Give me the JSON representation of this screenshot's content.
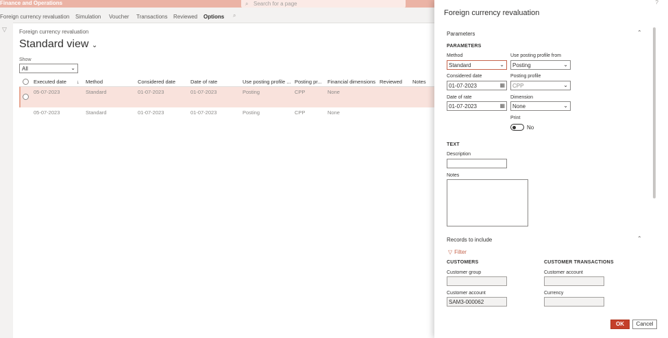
{
  "app": {
    "title": "Finance and Operations"
  },
  "search": {
    "placeholder": "Search for a page"
  },
  "actionbar": {
    "items": [
      "Foreign currency revaluation",
      "Simulation",
      "Voucher",
      "Transactions",
      "Reviewed",
      "Options"
    ],
    "active": "Options"
  },
  "main": {
    "breadcrumb": "Foreign currency revaluation",
    "view_title": "Standard view",
    "show_label": "Show",
    "show_value": "All",
    "columns": [
      "Executed date",
      "Method",
      "Considered date",
      "Date of rate",
      "Use posting profile ...",
      "Posting pr...",
      "Financial dimensions",
      "Reviewed",
      "Notes"
    ],
    "rows": [
      [
        "05-07-2023",
        "Standard",
        "01-07-2023",
        "01-07-2023",
        "Posting",
        "CPP",
        "None",
        "",
        ""
      ],
      [
        "05-07-2023",
        "Standard",
        "01-07-2023",
        "01-07-2023",
        "Posting",
        "CPP",
        "None",
        "",
        ""
      ]
    ]
  },
  "dialog": {
    "title": "Foreign currency revaluation",
    "parameters_section": "Parameters",
    "parameters_group": "PARAMETERS",
    "method_label": "Method",
    "method_value": "Standard",
    "use_posting_label": "Use posting profile from",
    "use_posting_value": "Posting",
    "considered_date_label": "Considered date",
    "considered_date_value": "01-07-2023",
    "posting_profile_label": "Posting profile",
    "posting_profile_value": "CPP",
    "date_of_rate_label": "Date of rate",
    "date_of_rate_value": "01-07-2023",
    "dimension_label": "Dimension",
    "dimension_value": "None",
    "print_label": "Print",
    "print_value": "No",
    "text_group": "TEXT",
    "description_label": "Description",
    "description_value": "",
    "notes_label": "Notes",
    "records_section": "Records to include",
    "filter_label": "Filter",
    "customers_group": "CUSTOMERS",
    "customer_group_label": "Customer group",
    "customer_group_value": "",
    "customer_account_label": "Customer account",
    "customer_account_value": "SAM3-000062",
    "cust_trans_group": "CUSTOMER TRANSACTIONS",
    "ct_customer_account_label": "Customer account",
    "ct_customer_account_value": "",
    "currency_label": "Currency",
    "currency_value": "",
    "ok_label": "OK",
    "cancel_label": "Cancel",
    "help_glyph": "?"
  }
}
